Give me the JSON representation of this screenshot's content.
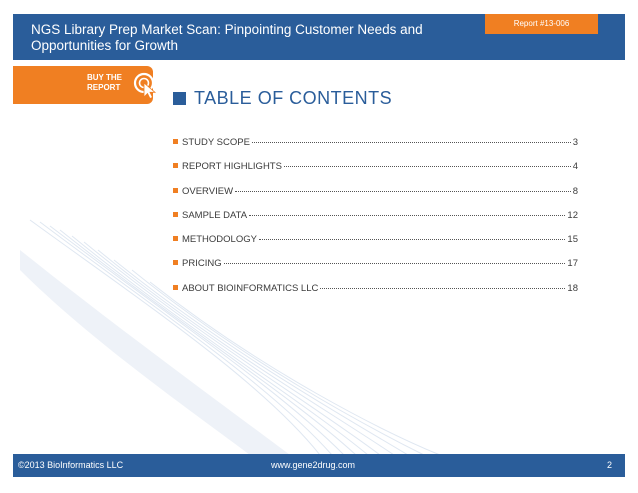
{
  "header": {
    "title": "NGS Library Prep Market Scan: Pinpointing Customer Needs and Opportunities for Growth",
    "report_id": "Report #13-006"
  },
  "buy_button": {
    "line1": "BUY THE",
    "line2": "REPORT",
    "icon": "cursor-click-icon"
  },
  "toc": {
    "title": "TABLE OF CONTENTS",
    "items": [
      {
        "label": "STUDY SCOPE",
        "page": "3"
      },
      {
        "label": "REPORT HIGHLIGHTS",
        "page": "4"
      },
      {
        "label": "OVERVIEW",
        "page": "8"
      },
      {
        "label": "SAMPLE DATA",
        "page": "12"
      },
      {
        "label": "METHODOLOGY",
        "page": "15"
      },
      {
        "label": "PRICING",
        "page": "17"
      },
      {
        "label": "ABOUT BIOINFORMATICS LLC",
        "page": "18"
      }
    ]
  },
  "footer": {
    "copyright": "©2013 BioInformatics LLC",
    "website": "www.gene2drug.com",
    "page": "2"
  },
  "colors": {
    "brand_blue": "#2a5d9a",
    "accent_orange": "#f07f22"
  }
}
